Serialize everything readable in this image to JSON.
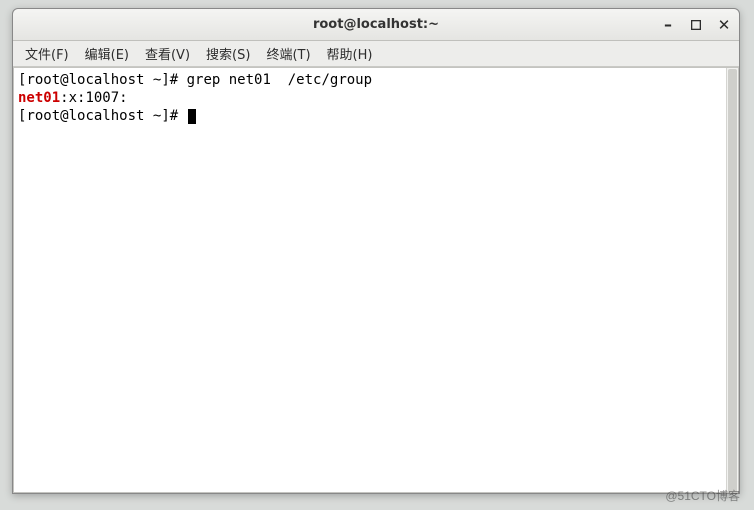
{
  "window": {
    "title": "root@localhost:~"
  },
  "menubar": {
    "items": [
      {
        "label": "文件(F)"
      },
      {
        "label": "编辑(E)"
      },
      {
        "label": "查看(V)"
      },
      {
        "label": "搜索(S)"
      },
      {
        "label": "终端(T)"
      },
      {
        "label": "帮助(H)"
      }
    ]
  },
  "terminal": {
    "line1_prompt_open": "[",
    "line1_user": "root@localhost",
    "line1_path": " ~",
    "line1_prompt_close": "]",
    "line1_hash": "# ",
    "line1_cmd": "grep net01  /etc/group",
    "line2_match": "net01",
    "line2_rest": ":x:1007:",
    "line3_prompt_open": "[",
    "line3_user": "root@localhost",
    "line3_path": " ~",
    "line3_prompt_close": "]",
    "line3_hash": "# "
  },
  "watermark": "@51CTO博客"
}
